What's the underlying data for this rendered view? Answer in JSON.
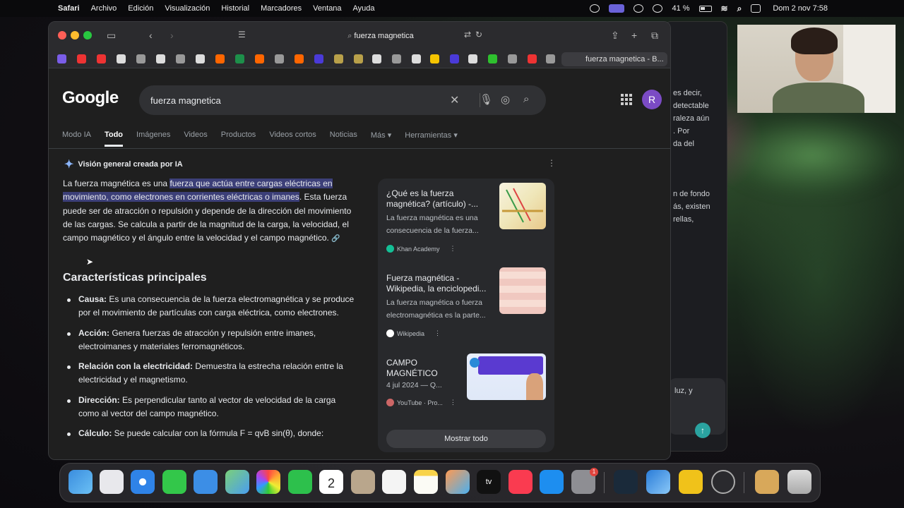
{
  "menubar": {
    "app": "Safari",
    "items": [
      "Archivo",
      "Edición",
      "Visualización",
      "Historial",
      "Marcadores",
      "Ventana",
      "Ayuda"
    ],
    "battery": "41 %",
    "clock": "Dom 2 nov 7:58"
  },
  "browser": {
    "address": "fuerza magnetica",
    "active_tab": "fuerza magnetica - B..."
  },
  "google": {
    "logo": "Google",
    "query": "fuerza magnetica",
    "avatar_letter": "R",
    "tabs": [
      "Modo IA",
      "Todo",
      "Imágenes",
      "Videos",
      "Productos",
      "Videos cortos",
      "Noticias",
      "Más ▾",
      "Herramientas ▾"
    ],
    "ai_header": "Visión general creada por IA",
    "overview_pre": "La fuerza magnética es una ",
    "overview_highlight": "fuerza que actúa entre cargas eléctricas en movimiento, como electrones en corrientes eléctricas o imanes",
    "overview_post": ". Esta fuerza puede ser de atracción o repulsión y depende de la dirección del movimiento de las cargas. Se calcula a partir de la magnitud de la carga, la velocidad, el campo magnético y el ángulo entre la velocidad y el campo magnético.",
    "section_title": "Características principales",
    "bullets": [
      {
        "label": "Causa:",
        "text": " Es una consecuencia de la fuerza electromagnética y se produce por el movimiento de partículas con carga eléctrica, como electrones."
      },
      {
        "label": "Acción:",
        "text": " Genera fuerzas de atracción y repulsión entre imanes, electroimanes y materiales ferromagnéticos."
      },
      {
        "label": "Relación con la electricidad:",
        "text": " Demuestra la estrecha relación entre la electricidad y el magnetismo."
      },
      {
        "label": "Dirección:",
        "text": " Es perpendicular tanto al vector de velocidad de la carga como al vector del campo magnético."
      },
      {
        "label": "Cálculo:",
        "text": " Se puede calcular con la fórmula F = qvB sin(θ), donde:"
      }
    ],
    "cards": [
      {
        "title": "¿Qué es la fuerza magnética? (artículo) -...",
        "desc": "La fuerza magnética es una consecuencia de la fuerza...",
        "source": "Khan Academy"
      },
      {
        "title": "Fuerza magnética - Wikipedia, la enciclopedi...",
        "desc": "La fuerza magnética o fuerza electromagnética es la parte...",
        "source": "Wikipedia"
      },
      {
        "title": "CAMPO MAGNÉTICO",
        "desc": "4 jul 2024 — Q...",
        "source": "YouTube · Pro..."
      }
    ],
    "show_all": "Mostrar todo"
  },
  "background_window": {
    "lines": [
      "es decir,",
      "detectable",
      "raleza aún",
      ". Por",
      "da del",
      "n de fondo",
      "ás, existen",
      "rellas,",
      "luz, y"
    ]
  },
  "colors": {
    "highlight": "#3c3f78",
    "avatar": "#7b4bc4",
    "ai_spark": "#8ab4f8"
  }
}
